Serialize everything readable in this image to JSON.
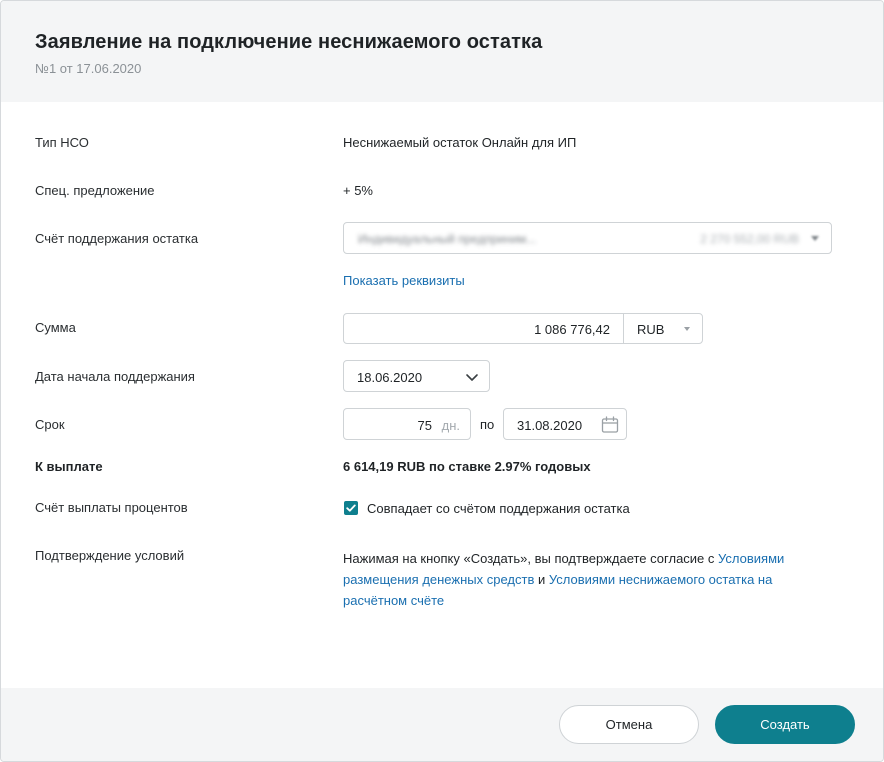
{
  "dialog": {
    "title": "Заявление на подключение неснижаемого остатка",
    "subtitle": "№1 от 17.06.2020"
  },
  "form": {
    "nso_type": {
      "label": "Тип НСО",
      "value": "Неснижаемый остаток Онлайн для ИП"
    },
    "special_offer": {
      "label": "Спец. предложение",
      "value": "+ 5%"
    },
    "account": {
      "label": "Счёт поддержания остатка",
      "name": "Индивидуальный предприним...",
      "balance": "2 270 552,00 RUB",
      "show_details_link": "Показать реквизиты"
    },
    "amount": {
      "label": "Сумма",
      "value": "1 086 776,42",
      "currency": "RUB"
    },
    "start_date": {
      "label": "Дата начала поддержания",
      "value": "18.06.2020"
    },
    "term": {
      "label": "Срок",
      "days": "75",
      "unit": "дн.",
      "separator": "по",
      "end_date": "31.08.2020"
    },
    "payout": {
      "label": "К выплате",
      "value": "6 614,19 RUB по ставке 2.97% годовых"
    },
    "interest_account": {
      "label": "Счёт выплаты процентов",
      "checkbox_label": "Совпадает со счётом поддержания остатка",
      "checked": true
    },
    "confirmation": {
      "label": "Подтверждение условий",
      "text_before": "Нажимая на кнопку «Создать», вы подтверждаете согласие с ",
      "link1": "Условиями размещения денежных средств",
      "text_middle": " и ",
      "link2": "Условиями неснижаемого остатка на расчётном счёте"
    }
  },
  "footer": {
    "cancel_label": "Отмена",
    "create_label": "Создать"
  },
  "colors": {
    "accent": "#0e7f8e",
    "link": "#1a6fb0",
    "header_bg": "#f4f5f6"
  },
  "icons": {
    "select": "chevron-down-icon",
    "date_select": "chevron-down-icon",
    "calendar": "calendar-icon",
    "check": "check-icon"
  }
}
